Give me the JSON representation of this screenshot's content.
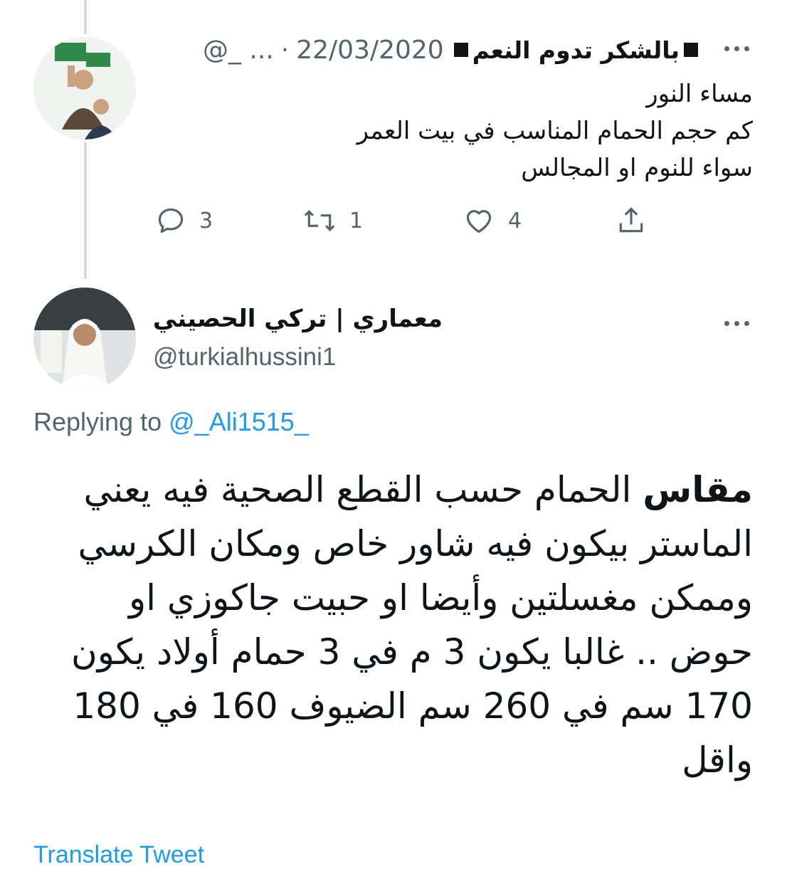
{
  "tweet1": {
    "display_name": "بالشكر تدوم النعم",
    "handle": "@_ ...",
    "separator": "·",
    "date": "22/03/2020",
    "lines": [
      "مساء النور",
      "كم حجم الحمام المناسب في بيت العمر",
      "سواء للنوم او المجالس"
    ],
    "actions": {
      "replies": "3",
      "retweets": "1",
      "likes": "4"
    }
  },
  "tweet2": {
    "display_name": "معماري | تركي الحصيني",
    "handle": "@turkialhussini1",
    "replying_prefix": "Replying to",
    "replying_handle": "@_Ali1515_",
    "bold_word": "مقاس",
    "body": " الحمام حسب القطع الصحية فيه يعني الماستر بيكون فيه شاور خاص ومكان الكرسي وممكن مغسلتين وأيضا او حبيت جاكوزي او حوض .. غالبا يكون 3 م في 3 حمام أولاد يكون 170 سم في 260 سم الضيوف 160 في 180 واقل",
    "translate_label": "Translate Tweet"
  },
  "colors": {
    "accent": "#1d9bf0",
    "secondary_text": "#536471",
    "thread_line": "#cfd9de"
  }
}
